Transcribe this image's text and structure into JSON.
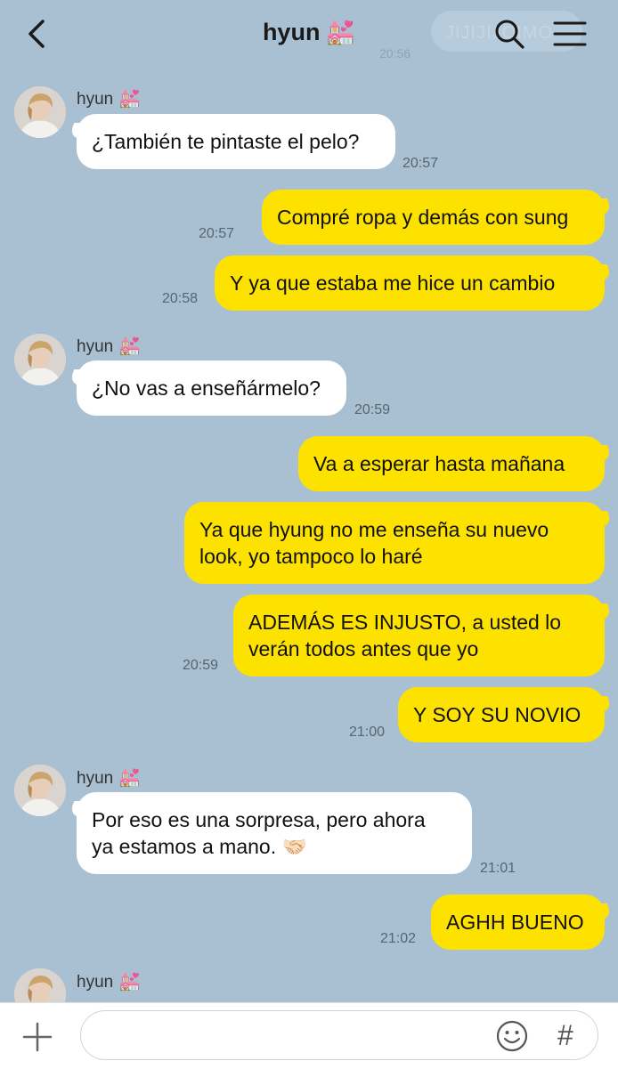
{
  "header": {
    "title": "hyun",
    "title_emoji": "💒",
    "ghost_text": "JIJIJIJOIMO",
    "ghost_time": "20:56",
    "icons": [
      "back-arrow-icon",
      "search-icon",
      "hamburger-menu-icon"
    ]
  },
  "contact": {
    "name": "hyun",
    "emoji": "💒"
  },
  "messages": [
    {
      "side": "in",
      "text_lines": [
        "¿También te pintaste el pelo?"
      ],
      "time": "20:57",
      "sender": "hyun"
    },
    {
      "side": "out",
      "text_lines": [
        "Compré ropa y demás con sung"
      ],
      "time": "20:57"
    },
    {
      "side": "out",
      "text_lines": [
        "Y ya que estaba me hice un cambio"
      ],
      "time": "20:58"
    },
    {
      "side": "in",
      "text_lines": [
        "¿No vas a enseñármelo?"
      ],
      "time": "20:59",
      "sender": "hyun"
    },
    {
      "side": "out",
      "text_lines": [
        "Va a esperar hasta mañana"
      ],
      "time": ""
    },
    {
      "side": "out",
      "text_lines": [
        "Ya que hyung no me enseña su nuevo",
        "look, yo tampoco lo haré"
      ],
      "time": ""
    },
    {
      "side": "out",
      "text_lines": [
        "ADEMÁS ES INJUSTO, a usted lo",
        "verán todos antes que yo"
      ],
      "time": "20:59"
    },
    {
      "side": "out",
      "text_lines": [
        "Y SOY SU NOVIO"
      ],
      "time": "21:00"
    },
    {
      "side": "in",
      "text_lines": [
        "Por eso es una sorpresa, pero ahora",
        "ya estamos a mano. 🤝🏻"
      ],
      "time": "21:01",
      "sender": "hyun"
    },
    {
      "side": "out",
      "text_lines": [
        "AGHH BUENO"
      ],
      "time": "21:02"
    },
    {
      "side": "in",
      "text_lines": [],
      "time": "",
      "sender": "hyun"
    }
  ],
  "footer": {
    "input_value": "",
    "input_placeholder": "",
    "hash_symbol": "#",
    "icons": [
      "plus-icon",
      "emoji-smile-icon",
      "hashtag-icon"
    ]
  },
  "colors": {
    "background": "#a9c0d3",
    "outgoing": "#fde200",
    "incoming": "#ffffff"
  }
}
